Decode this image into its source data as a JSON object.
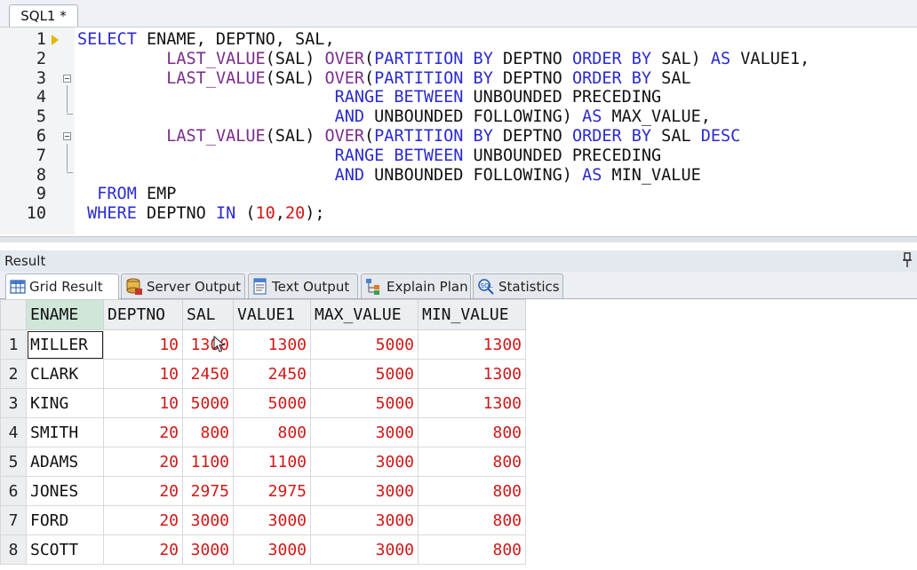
{
  "editor_tab": {
    "label": "SQL1 *"
  },
  "editor": {
    "lines": [
      {
        "num": "1",
        "tokens": [
          {
            "t": "SELECT",
            "c": "kw"
          },
          {
            "t": " ENAME, DEPTNO, SAL,",
            "c": "tx"
          }
        ]
      },
      {
        "num": "2",
        "tokens": [
          {
            "t": "         ",
            "c": "tx"
          },
          {
            "t": "LAST_VALUE",
            "c": "fn"
          },
          {
            "t": "(SAL) ",
            "c": "tx"
          },
          {
            "t": "OVER",
            "c": "fn"
          },
          {
            "t": "(",
            "c": "tx"
          },
          {
            "t": "PARTITION BY",
            "c": "kw"
          },
          {
            "t": " DEPTNO ",
            "c": "tx"
          },
          {
            "t": "ORDER BY",
            "c": "kw"
          },
          {
            "t": " SAL) ",
            "c": "tx"
          },
          {
            "t": "AS",
            "c": "kw"
          },
          {
            "t": " VALUE1,",
            "c": "tx"
          }
        ]
      },
      {
        "num": "3",
        "tokens": [
          {
            "t": "         ",
            "c": "tx"
          },
          {
            "t": "LAST_VALUE",
            "c": "fn"
          },
          {
            "t": "(SAL) ",
            "c": "tx"
          },
          {
            "t": "OVER",
            "c": "fn"
          },
          {
            "t": "(",
            "c": "tx"
          },
          {
            "t": "PARTITION BY",
            "c": "kw"
          },
          {
            "t": " DEPTNO ",
            "c": "tx"
          },
          {
            "t": "ORDER BY",
            "c": "kw"
          },
          {
            "t": " SAL",
            "c": "tx"
          }
        ]
      },
      {
        "num": "4",
        "tokens": [
          {
            "t": "                          ",
            "c": "tx"
          },
          {
            "t": "RANGE BETWEEN",
            "c": "kw"
          },
          {
            "t": " UNBOUNDED PRECEDING",
            "c": "tx"
          }
        ]
      },
      {
        "num": "5",
        "tokens": [
          {
            "t": "                          ",
            "c": "tx"
          },
          {
            "t": "AND",
            "c": "kw"
          },
          {
            "t": " UNBOUNDED FOLLOWING) ",
            "c": "tx"
          },
          {
            "t": "AS",
            "c": "kw"
          },
          {
            "t": " MAX_VALUE,",
            "c": "tx"
          }
        ]
      },
      {
        "num": "6",
        "tokens": [
          {
            "t": "         ",
            "c": "tx"
          },
          {
            "t": "LAST_VALUE",
            "c": "fn"
          },
          {
            "t": "(SAL) ",
            "c": "tx"
          },
          {
            "t": "OVER",
            "c": "fn"
          },
          {
            "t": "(",
            "c": "tx"
          },
          {
            "t": "PARTITION BY",
            "c": "kw"
          },
          {
            "t": " DEPTNO ",
            "c": "tx"
          },
          {
            "t": "ORDER BY",
            "c": "kw"
          },
          {
            "t": " SAL ",
            "c": "tx"
          },
          {
            "t": "DESC",
            "c": "kw"
          }
        ]
      },
      {
        "num": "7",
        "tokens": [
          {
            "t": "                          ",
            "c": "tx"
          },
          {
            "t": "RANGE BETWEEN",
            "c": "kw"
          },
          {
            "t": " UNBOUNDED PRECEDING",
            "c": "tx"
          }
        ]
      },
      {
        "num": "8",
        "tokens": [
          {
            "t": "                          ",
            "c": "tx"
          },
          {
            "t": "AND",
            "c": "kw"
          },
          {
            "t": " UNBOUNDED FOLLOWING) ",
            "c": "tx"
          },
          {
            "t": "AS",
            "c": "kw"
          },
          {
            "t": " MIN_VALUE",
            "c": "tx"
          }
        ]
      },
      {
        "num": "9",
        "tokens": [
          {
            "t": "  ",
            "c": "tx"
          },
          {
            "t": "FROM",
            "c": "kw"
          },
          {
            "t": " EMP",
            "c": "tx"
          }
        ]
      },
      {
        "num": "10",
        "tokens": [
          {
            "t": " ",
            "c": "tx"
          },
          {
            "t": "WHERE",
            "c": "kw"
          },
          {
            "t": " DEPTNO ",
            "c": "tx"
          },
          {
            "t": "IN",
            "c": "kw"
          },
          {
            "t": " (",
            "c": "tx"
          },
          {
            "t": "10",
            "c": "num"
          },
          {
            "t": ",",
            "c": "tx"
          },
          {
            "t": "20",
            "c": "num"
          },
          {
            "t": ");",
            "c": "tx"
          }
        ]
      }
    ]
  },
  "result": {
    "title": "Result",
    "tabs": [
      {
        "label": "Grid Result",
        "icon": "grid-icon",
        "active": true
      },
      {
        "label": "Server Output",
        "icon": "server-output-icon",
        "active": false
      },
      {
        "label": "Text Output",
        "icon": "text-output-icon",
        "active": false
      },
      {
        "label": "Explain Plan",
        "icon": "explain-plan-icon",
        "active": false
      },
      {
        "label": "Statistics",
        "icon": "statistics-icon",
        "active": false
      }
    ],
    "grid": {
      "columns": [
        "ENAME",
        "DEPTNO",
        "SAL",
        "VALUE1",
        "MAX_VALUE",
        "MIN_VALUE"
      ],
      "rows": [
        [
          "1",
          "MILLER",
          "10",
          "1300",
          "1300",
          "5000",
          "1300"
        ],
        [
          "2",
          "CLARK",
          "10",
          "2450",
          "2450",
          "5000",
          "1300"
        ],
        [
          "3",
          "KING",
          "10",
          "5000",
          "5000",
          "5000",
          "1300"
        ],
        [
          "4",
          "SMITH",
          "20",
          "800",
          "800",
          "3000",
          "800"
        ],
        [
          "5",
          "ADAMS",
          "20",
          "1100",
          "1100",
          "3000",
          "800"
        ],
        [
          "6",
          "JONES",
          "20",
          "2975",
          "2975",
          "3000",
          "800"
        ],
        [
          "7",
          "FORD",
          "20",
          "3000",
          "3000",
          "3000",
          "800"
        ],
        [
          "8",
          "SCOTT",
          "20",
          "3000",
          "3000",
          "3000",
          "800"
        ]
      ]
    }
  }
}
